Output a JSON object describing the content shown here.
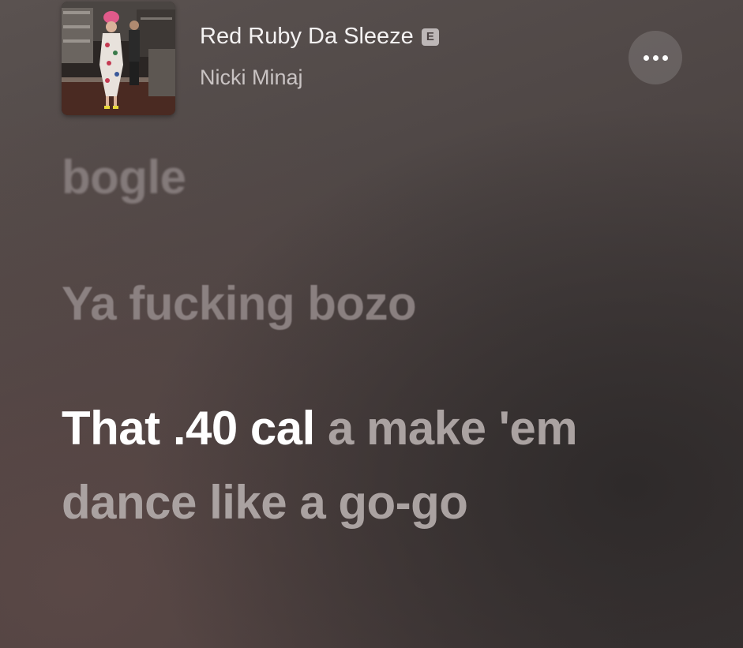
{
  "now_playing": {
    "title": "Red Ruby Da Sleeze",
    "explicit_badge": "E",
    "artist": "Nicki Minaj",
    "more_icon": "ellipsis-icon"
  },
  "lyrics": {
    "faded_above": "",
    "past_line": "bogle",
    "previous_line": "Ya fucking bozo",
    "current_line": {
      "sung": "That .40 cal",
      "unsung": " a make 'em dance like a go-go"
    }
  },
  "colors": {
    "sung_text": "#ffffff",
    "unsung_text": "#aaa2a1",
    "inactive_text": "#8c8282",
    "background": "#4c4443"
  }
}
